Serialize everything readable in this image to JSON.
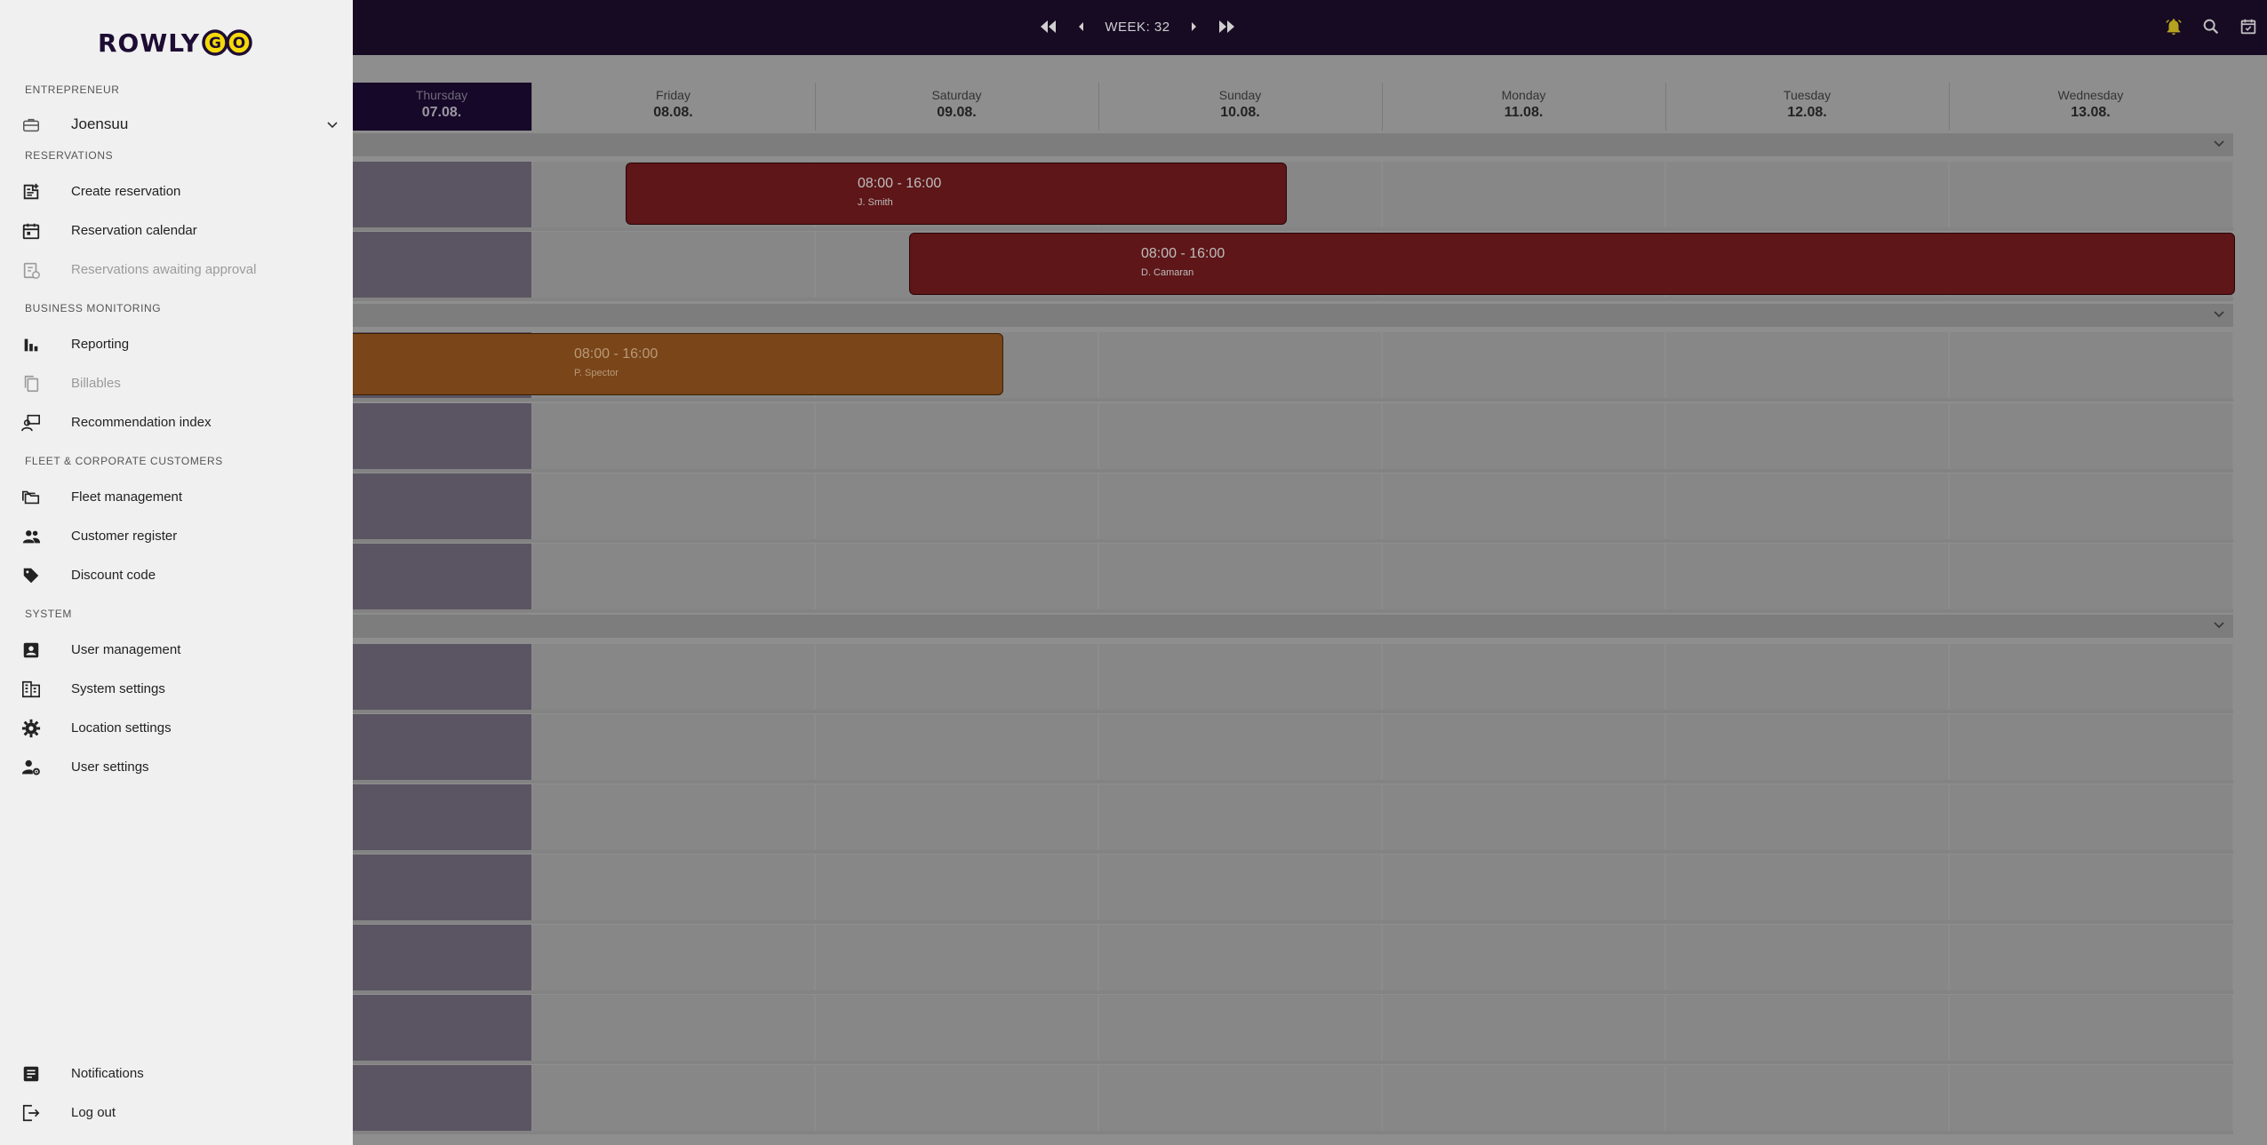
{
  "topbar": {
    "week_label": "WEEK: 32",
    "icons": [
      "first-page-icon",
      "prev-icon",
      "next-icon",
      "last-page-icon",
      "bell-icon",
      "search-icon",
      "calendar-icon"
    ],
    "bell_color": "#b5a21e"
  },
  "calendar": {
    "days": [
      {
        "name": "Thursday",
        "date": "07.08."
      },
      {
        "name": "Friday",
        "date": "08.08."
      },
      {
        "name": "Saturday",
        "date": "09.08."
      },
      {
        "name": "Sunday",
        "date": "10.08."
      },
      {
        "name": "Monday",
        "date": "11.08."
      },
      {
        "name": "Tuesday",
        "date": "12.08."
      },
      {
        "name": "Wednesday",
        "date": "13.08."
      }
    ],
    "bookings": [
      {
        "time": "08:00 - 16:00",
        "name": "J. Smith",
        "color": "#5e1618"
      },
      {
        "time": "08:00 - 16:00",
        "name": "D. Camaran",
        "color": "#5e1618"
      },
      {
        "time": "08:00 - 16:00",
        "name": "P. Spector",
        "color": "#7a4519"
      }
    ]
  },
  "sidebar": {
    "brand": "ROWLY",
    "brand_suffix": "GO",
    "brand_accent": "#f5d90a",
    "entrepreneur_label": "ENTREPRENEUR",
    "entrepreneur_value": "Joensuu",
    "sections": {
      "reservations": "RESERVATIONS",
      "business": "BUSINESS MONITORING",
      "fleet": "FLEET & CORPORATE CUSTOMERS",
      "system": "SYSTEM"
    },
    "items": {
      "create_reservation": "Create reservation",
      "reservation_calendar": "Reservation calendar",
      "awaiting_approval": "Reservations awaiting approval",
      "reporting": "Reporting",
      "billables": "Billables",
      "recommendation": "Recommendation index",
      "fleet": "Fleet management",
      "customer": "Customer register",
      "discount": "Discount code",
      "user_mgmt": "User management",
      "system_settings": "System settings",
      "location_settings": "Location settings",
      "user_settings": "User settings",
      "notifications": "Notifications",
      "logout": "Log out"
    }
  }
}
